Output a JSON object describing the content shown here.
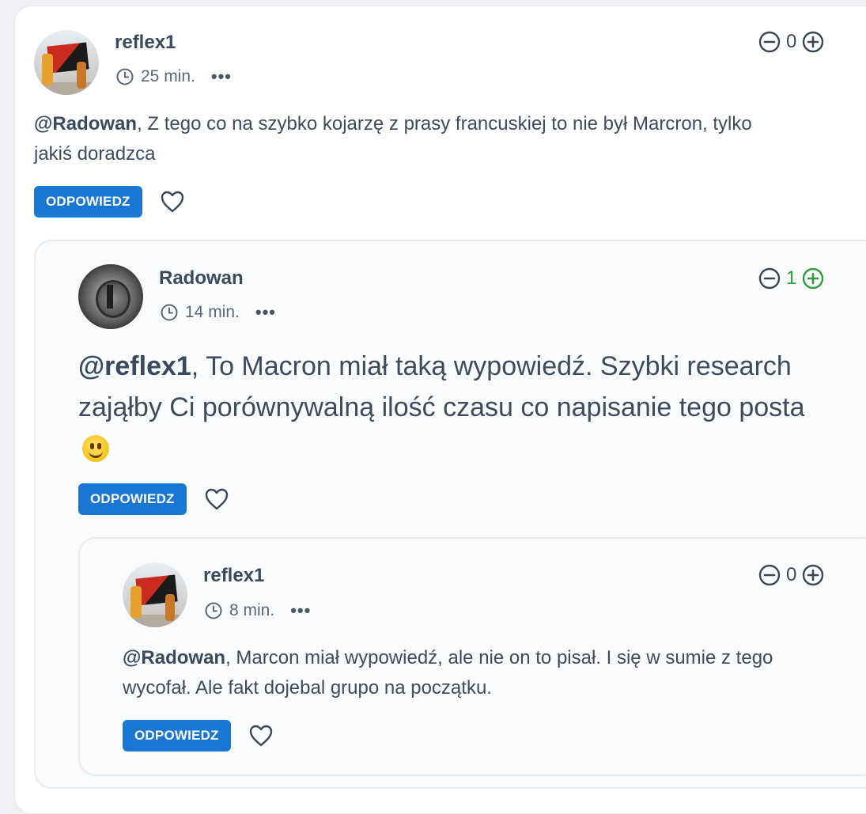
{
  "comments": [
    {
      "author": "reflex1",
      "time": "25 min.",
      "more": "•••",
      "score": "0",
      "mention": "@Radowan",
      "text_line1": ", Z tego co na szybko kojarzę z prasy francuskiej to nie był Marcron, tylko",
      "text_line2": "jakiś doradzca",
      "reply_label": "ODPOWIEDZ"
    },
    {
      "author": "Radowan",
      "time": "14 min.",
      "more": "•••",
      "score": "1",
      "mention": "@reflex1",
      "text_line1": ", To Macron miał taką wypowiedź. Szybki research",
      "text_line2": "zająłby Ci porównywalną ilość czasu co napisanie tego posta",
      "emoji": "slightly-smiling-face",
      "reply_label": "ODPOWIEDZ"
    },
    {
      "author": "reflex1",
      "time": "8 min.",
      "more": "•••",
      "score": "0",
      "mention": "@Radowan",
      "text_line1": ", Marcon miał wypowiedź, ale nie on to pisał. I się w sumie z tego",
      "text_line2": "wycofał. Ale fakt dojebal grupo na początku.",
      "reply_label": "ODPOWIEDZ"
    }
  ],
  "colors": {
    "accent": "#1976d2",
    "positive": "#2e9e3a",
    "text": "#3e4b5d"
  }
}
